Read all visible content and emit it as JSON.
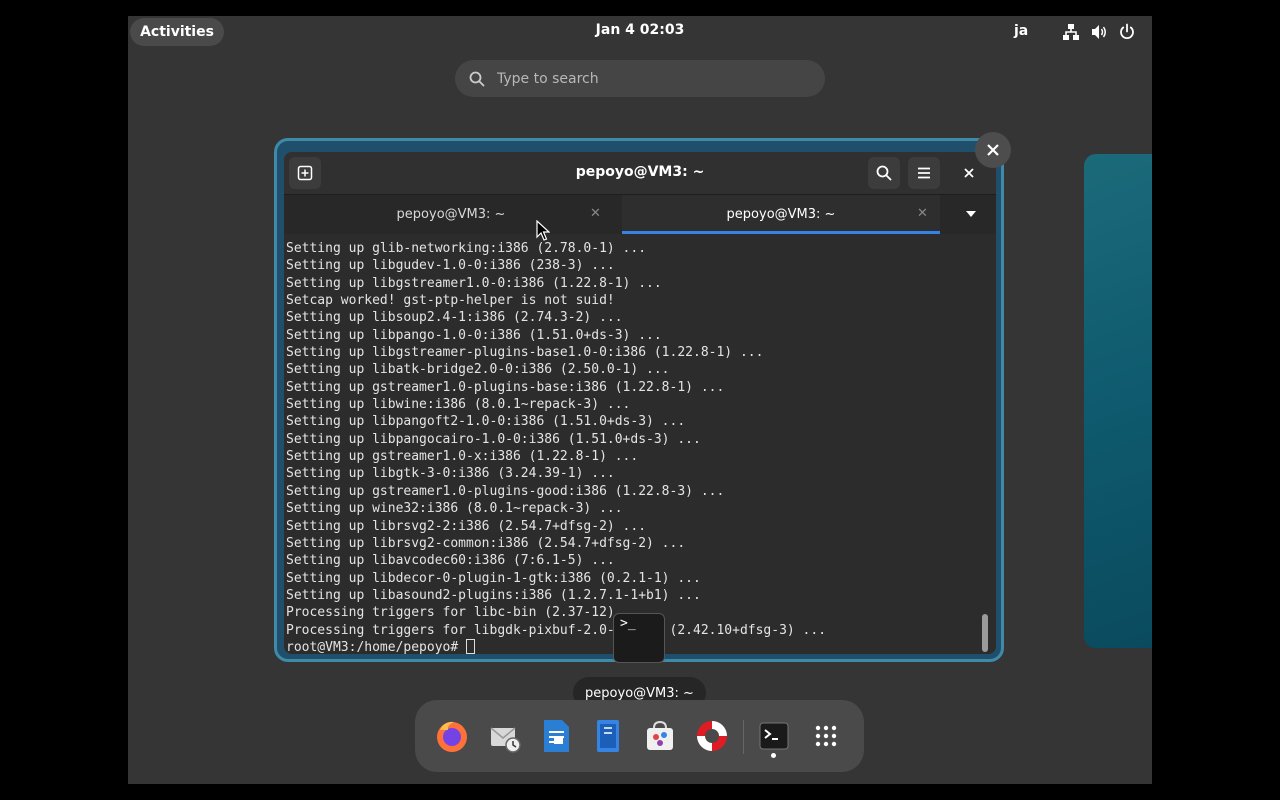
{
  "topbar": {
    "activities_label": "Activities",
    "clock": "Jan 4  02:03",
    "input_method": "ja"
  },
  "search": {
    "placeholder": "Type to search"
  },
  "window": {
    "title": "pepoyo@VM3: ~",
    "tabs": [
      {
        "label": "pepoyo@VM3: ~",
        "active": false
      },
      {
        "label": "pepoyo@VM3: ~",
        "active": true
      }
    ],
    "terminal_lines": [
      "Setting up glib-networking:i386 (2.78.0-1) ...",
      "Setting up libgudev-1.0-0:i386 (238-3) ...",
      "Setting up libgstreamer1.0-0:i386 (1.22.8-1) ...",
      "Setcap worked! gst-ptp-helper is not suid!",
      "Setting up libsoup2.4-1:i386 (2.74.3-2) ...",
      "Setting up libpango-1.0-0:i386 (1.51.0+ds-3) ...",
      "Setting up libgstreamer-plugins-base1.0-0:i386 (1.22.8-1) ...",
      "Setting up libatk-bridge2.0-0:i386 (2.50.0-1) ...",
      "Setting up gstreamer1.0-plugins-base:i386 (1.22.8-1) ...",
      "Setting up libwine:i386 (8.0.1~repack-3) ...",
      "Setting up libpangoft2-1.0-0:i386 (1.51.0+ds-3) ...",
      "Setting up libpangocairo-1.0-0:i386 (1.51.0+ds-3) ...",
      "Setting up gstreamer1.0-x:i386 (1.22.8-1) ...",
      "Setting up libgtk-3-0:i386 (3.24.39-1) ...",
      "Setting up gstreamer1.0-plugins-good:i386 (1.22.8-3) ...",
      "Setting up wine32:i386 (8.0.1~repack-3) ...",
      "Setting up librsvg2-2:i386 (2.54.7+dfsg-2) ...",
      "Setting up librsvg2-common:i386 (2.54.7+dfsg-2) ...",
      "Setting up libavcodec60:i386 (7:6.1-5) ...",
      "Setting up libdecor-0-plugin-1-gtk:i386 (0.2.1-1) ...",
      "Setting up libasound2-plugins:i386 (1.2.7.1-1+b1) ...",
      "Processing triggers for libc-bin (2.37-12) ...",
      "Processing triggers for libgdk-pixbuf-2.0-0:i386 (2.42.10+dfsg-3) ..."
    ],
    "prompt": "root@VM3:/home/pepoyo# "
  },
  "app_thumbnail_glyph": ">_",
  "tooltip": "pepoyo@VM3: ~",
  "dock": {
    "items": [
      "firefox-icon",
      "evolution-icon",
      "writer-icon",
      "files-icon",
      "software-icon",
      "help-icon",
      "terminal-icon",
      "app-grid-icon"
    ],
    "running": "terminal-icon"
  },
  "colors": {
    "accent": "#3584e4",
    "panel": "#353535",
    "dock": "#4a4a4a"
  }
}
